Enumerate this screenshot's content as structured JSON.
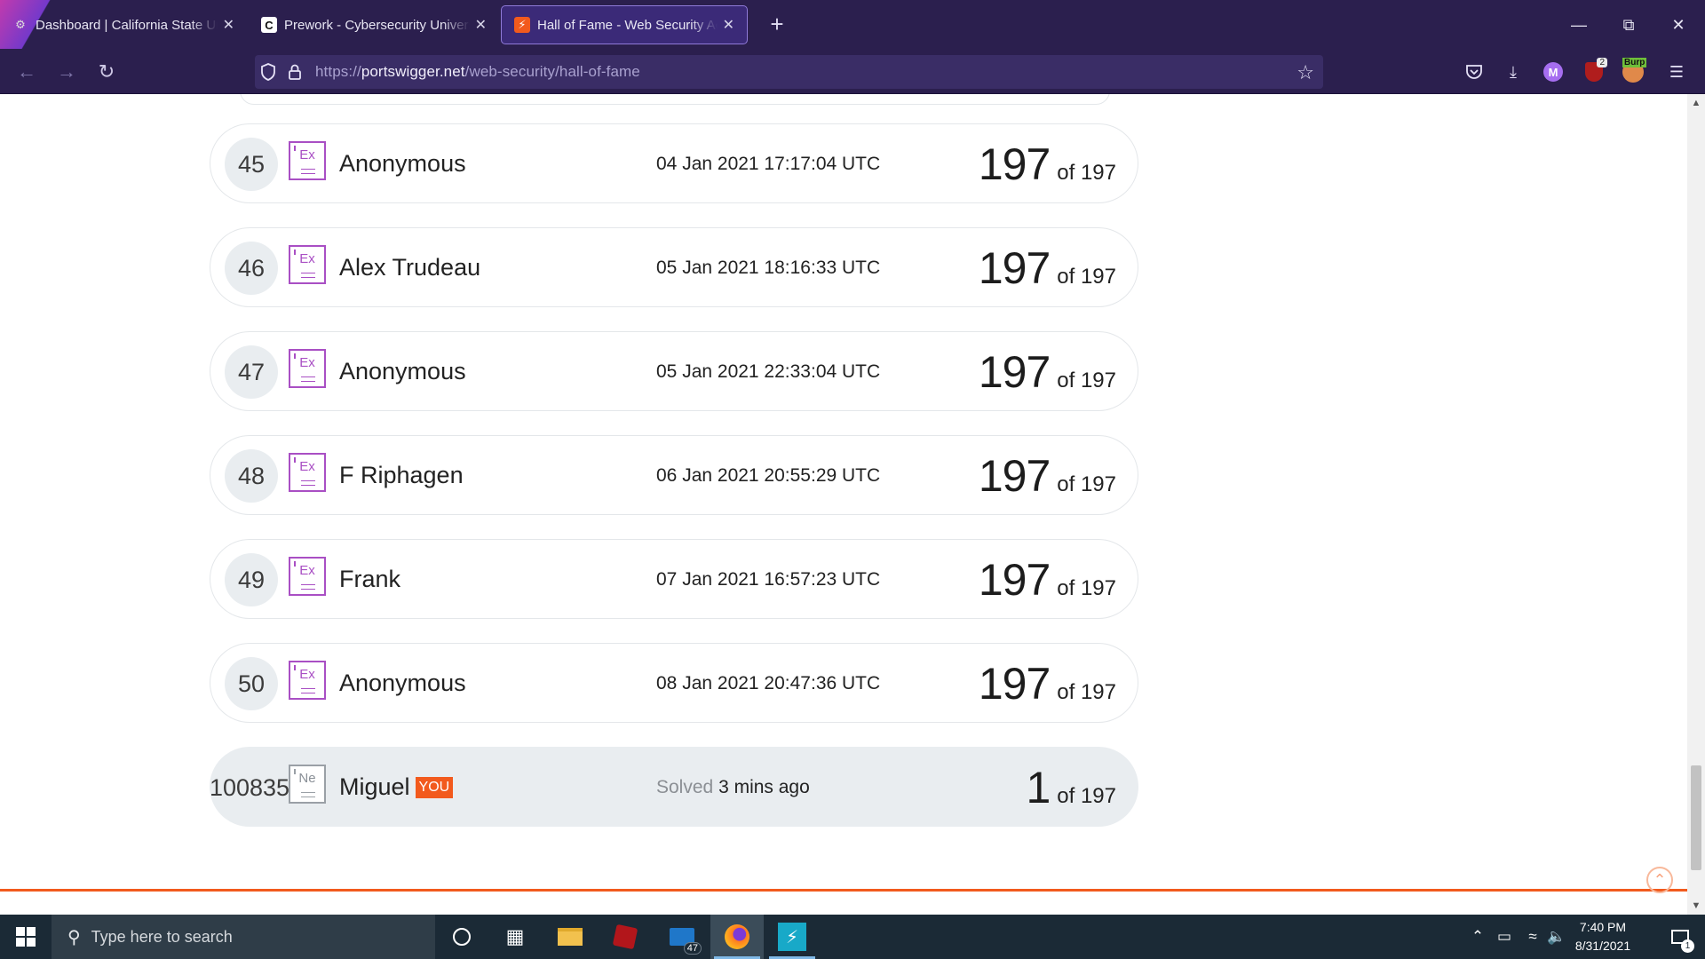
{
  "browser": {
    "tabs": [
      {
        "title": "Dashboard | California State Un",
        "icon": "dashboard-favicon",
        "active": false
      },
      {
        "title": "Prework - Cybersecurity Univers",
        "icon": "codepath-favicon",
        "favicon_text": "C",
        "active": false
      },
      {
        "title": "Hall of Fame - Web Security Ac",
        "icon": "portswigger-favicon",
        "active": true
      }
    ],
    "url": {
      "scheme": "https://",
      "host": "portswigger.net",
      "path": "/web-security/hall-of-fame"
    },
    "extensions": {
      "account_initial": "M",
      "ublock_count": "2",
      "burp_label": "Burp"
    }
  },
  "leaderboard": [
    {
      "rank": "45",
      "level": "Ex",
      "name": "Anonymous",
      "date": "04 Jan 2021 17:17:04 UTC",
      "solved": "197",
      "total": "of 197"
    },
    {
      "rank": "46",
      "level": "Ex",
      "name": "Alex Trudeau",
      "date": "05 Jan 2021 18:16:33 UTC",
      "solved": "197",
      "total": "of 197"
    },
    {
      "rank": "47",
      "level": "Ex",
      "name": "Anonymous",
      "date": "05 Jan 2021 22:33:04 UTC",
      "solved": "197",
      "total": "of 197"
    },
    {
      "rank": "48",
      "level": "Ex",
      "name": "F Riphagen",
      "date": "06 Jan 2021 20:55:29 UTC",
      "solved": "197",
      "total": "of 197"
    },
    {
      "rank": "49",
      "level": "Ex",
      "name": "Frank",
      "date": "07 Jan 2021 16:57:23 UTC",
      "solved": "197",
      "total": "of 197"
    },
    {
      "rank": "50",
      "level": "Ex",
      "name": "Anonymous",
      "date": "08 Jan 2021 20:47:36 UTC",
      "solved": "197",
      "total": "of 197"
    }
  ],
  "current_user": {
    "rank": "100835",
    "level": "Ne",
    "name": "Miguel",
    "tag": "YOU",
    "solved_prefix": "Solved",
    "solved_when": "3 mins ago",
    "solved": "1",
    "total": "of 197"
  },
  "colors": {
    "accent": "#f25a1d",
    "expert_level": "#a94fc4",
    "browser_chrome": "#2b1f4e"
  },
  "taskbar": {
    "search_placeholder": "Type here to search",
    "mail_count": "47",
    "time": "7:40 PM",
    "date": "8/31/2021",
    "notification_count": "1"
  }
}
